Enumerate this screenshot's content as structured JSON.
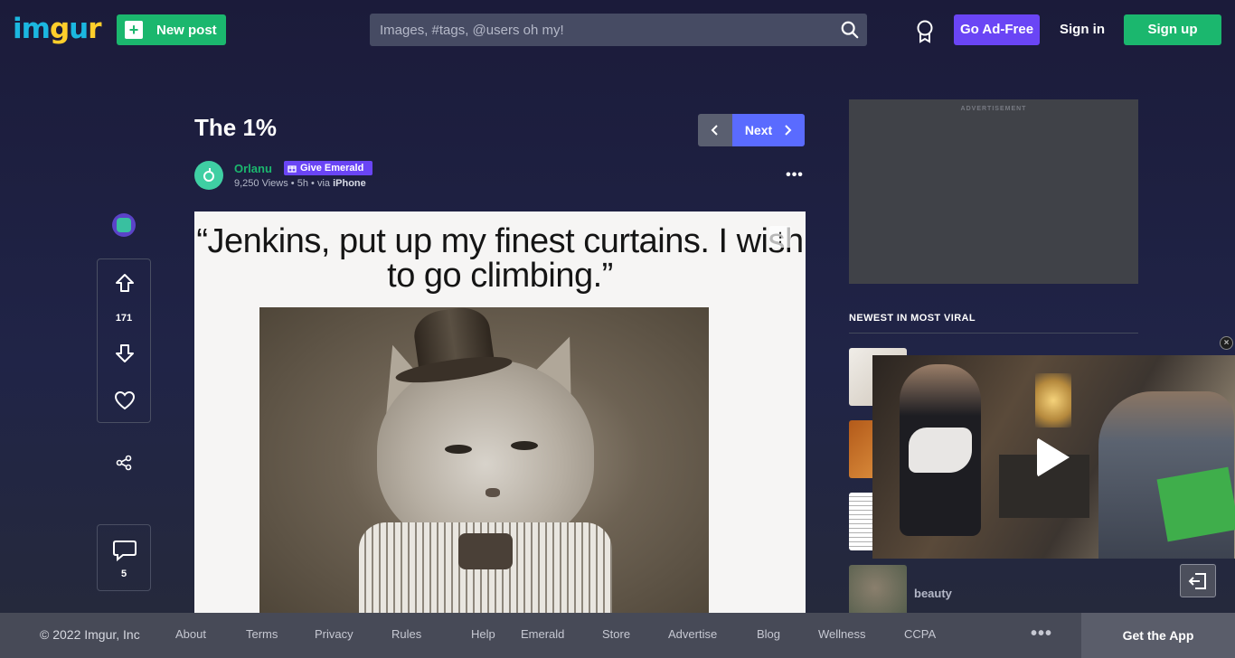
{
  "header": {
    "logo_text": "imgur",
    "new_post_label": "New post",
    "search_placeholder": "Images, #tags, @users oh my!",
    "ad_free_label": "Go Ad-Free",
    "sign_in_label": "Sign in",
    "sign_up_label": "Sign up"
  },
  "post": {
    "title": "The 1%",
    "nav_next_label": "Next",
    "author": "Orlanu",
    "give_emerald_label": "Give Emerald",
    "views": "9,250 Views",
    "time_ago": "5h",
    "via_label": "via",
    "via_source": "iPhone",
    "image_caption": "“Jenkins, put up my finest curtains. I wish to go climbing.”",
    "vote_count": "171",
    "comment_count": "5"
  },
  "sidebar": {
    "ad_label": "ADVERTISEMENT",
    "viral_heading": "NEWEST IN MOST VIRAL",
    "thumb_title_4": "beauty"
  },
  "footer": {
    "copyright": "© 2022 Imgur, Inc",
    "links": [
      "About",
      "Terms",
      "Privacy",
      "Rules",
      "Help",
      "Emerald",
      "Store",
      "Advertise",
      "Blog",
      "Wellness",
      "CCPA"
    ],
    "get_app_label": "Get the App"
  },
  "colors": {
    "brand_green": "#1bb76e",
    "emerald_purple": "#6a45f5",
    "next_blue": "#5a6bff",
    "logo_blue": "#1bb7e0",
    "logo_yellow": "#ffce2b"
  }
}
